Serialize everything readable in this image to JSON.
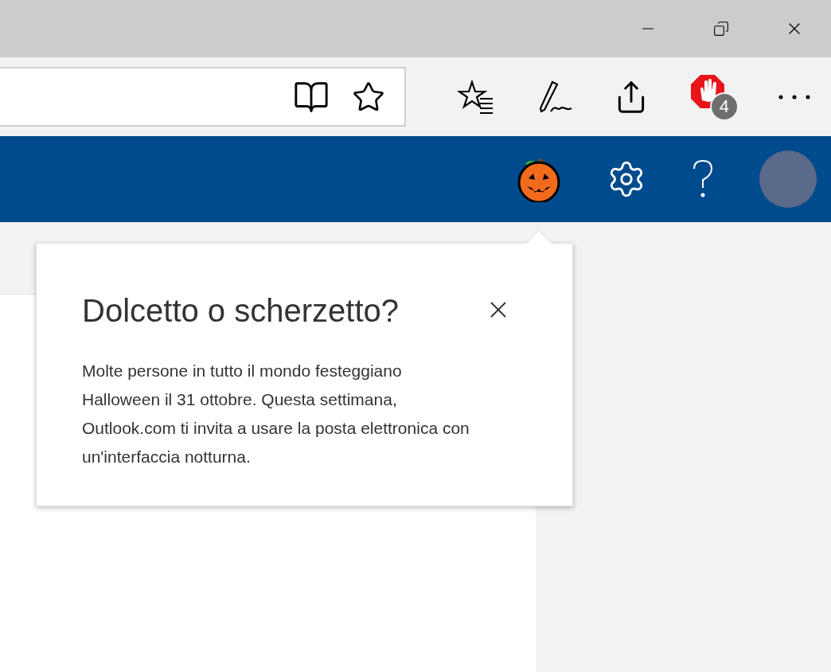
{
  "browser_toolbar": {
    "adblock_badge": "4"
  },
  "popup": {
    "title": "Dolcetto o scherzetto?",
    "body": "Molte persone in tutto il mondo festeggiano Halloween il 31 ottobre. Questa settimana, Outlook.com ti invita a usare la posta elettronica con un'interfaccia notturna."
  }
}
